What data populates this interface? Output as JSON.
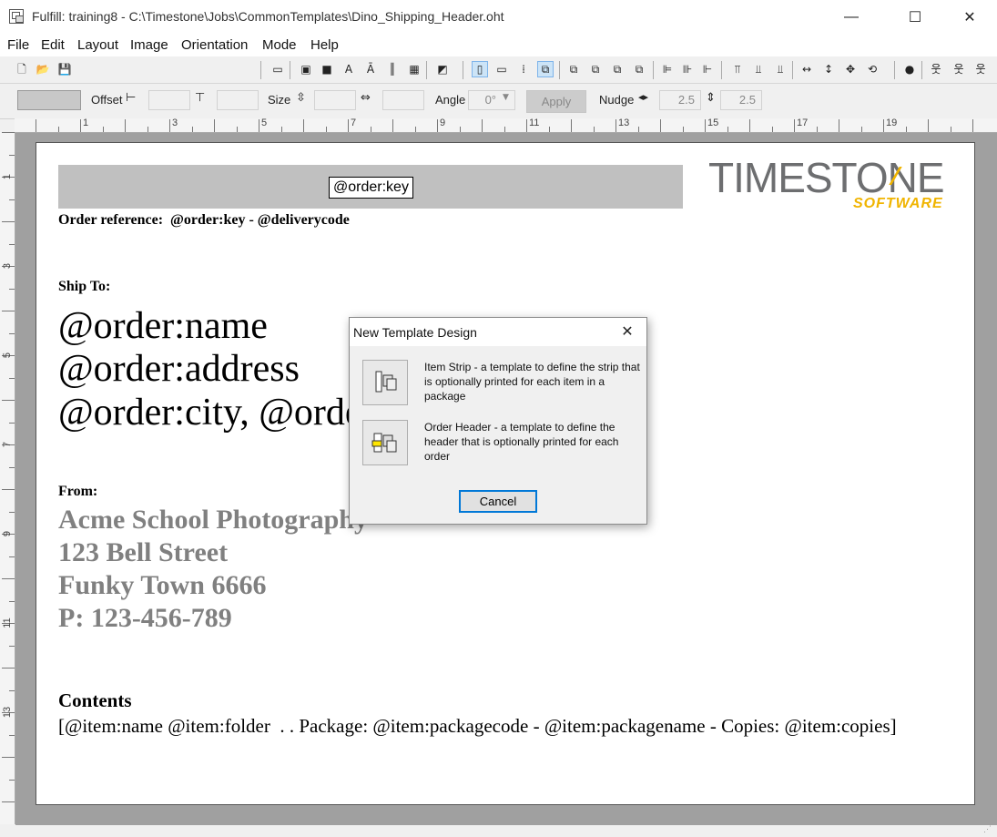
{
  "window": {
    "title": "Fulfill: training8 - C:\\Timestone\\Jobs\\CommonTemplates\\Dino_Shipping_Header.oht",
    "minimize": "—",
    "maximize": "☐",
    "close": "✕"
  },
  "menu": [
    "File",
    "Edit",
    "Layout",
    "Image",
    "Orientation",
    "Mode",
    "Help"
  ],
  "toolbar": {
    "icons": [
      "new-document-icon",
      "open-folder-icon",
      "save-icon",
      "select-rect-icon",
      "image-icon",
      "image-fill-icon",
      "text-icon",
      "text-box-icon",
      "barcode-icon",
      "grid-pattern-icon",
      "tag-icon",
      "page-layout-icon",
      "frame-layout-icon",
      "dotted-grid-icon",
      "group-icon",
      "bring-forward-icon",
      "send-backward-icon",
      "bring-front-icon",
      "send-back-icon",
      "align-left-icon",
      "align-center-icon",
      "align-right-icon",
      "align-top-icon",
      "align-middle-icon",
      "align-bottom-icon",
      "same-width-icon",
      "same-height-icon",
      "same-size-icon",
      "rotate-icon",
      "record-icon",
      "person-left-icon",
      "person-center-icon",
      "person-right-icon"
    ]
  },
  "propbar": {
    "offset_label": "Offset",
    "size_label": "Size",
    "angle_label": "Angle",
    "angle_value": "0°",
    "apply_label": "Apply",
    "nudge_label": "Nudge",
    "nudge_x": "2.5",
    "nudge_y": "2.5"
  },
  "ruler": {
    "h_labels": [
      "1",
      "3",
      "5",
      "7",
      "9",
      "11",
      "13",
      "15",
      "17",
      "19"
    ],
    "v_labels": [
      "1",
      "3",
      "5",
      "7",
      "9",
      "11",
      "13"
    ]
  },
  "page": {
    "order_key_box": "@order:key",
    "order_reference": "Order reference:  @order:key - @deliverycode",
    "ship_to_label": "Ship To:",
    "order_name": "@order:name",
    "order_address": "@order:address",
    "order_city": "@order:city, @order:state @order:zip",
    "from_label": "From:",
    "from_lines": [
      "Acme School Photography",
      "123 Bell Street",
      "Funky Town 6666",
      "P: 123-456-789"
    ],
    "contents_label": "Contents",
    "contents_line": "[@item:name @item:folder  . . Package: @item:packagecode - @item:packagename - Copies: @item:copies]",
    "logo_main": "TIMESTONE",
    "logo_sub": "SOFTWARE",
    "logo_accent_color": "#f0b400",
    "logo_main_color": "#6d6e70"
  },
  "dialog": {
    "title": "New Template Design",
    "item_strip_text": "Item Strip - a template to define the strip that is optionally printed for each item in a package",
    "order_header_text": "Order Header - a template to define the header that is optionally printed for each order",
    "cancel_label": "Cancel"
  }
}
